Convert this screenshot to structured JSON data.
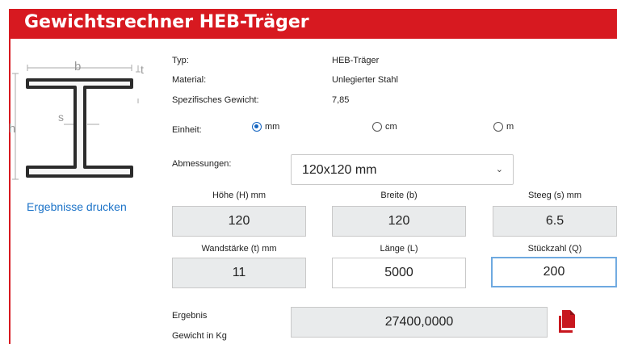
{
  "header": {
    "title": "Gewichtsrechner HEB-Träger"
  },
  "diagram": {
    "label_b": "b",
    "label_t": "t",
    "label_s": "s",
    "label_h": "h"
  },
  "sidebar": {
    "print_link": "Ergebnisse drucken"
  },
  "info": [
    {
      "label": "Typ:",
      "value": "HEB-Träger"
    },
    {
      "label": "Material:",
      "value": "Unlegierter Stahl"
    },
    {
      "label": "Spezifisches Gewicht:",
      "value": "7,85"
    }
  ],
  "unit": {
    "label": "Einheit:",
    "options": [
      {
        "label": "mm",
        "checked": true
      },
      {
        "label": "cm",
        "checked": false
      },
      {
        "label": "m",
        "checked": false
      }
    ]
  },
  "dimensions": {
    "label": "Abmessungen:",
    "selected": "120x120 mm"
  },
  "fields": {
    "height": {
      "label": "Höhe (H) mm",
      "value": "120"
    },
    "width": {
      "label": "Breite (b)",
      "value": "120"
    },
    "web": {
      "label": "Steeg (s) mm",
      "value": "6.5"
    },
    "thickness": {
      "label": "Wandstärke (t) mm",
      "value": "11"
    },
    "length": {
      "label": "Länge (L)",
      "value": "5000"
    },
    "quantity": {
      "label": "Stückzahl (Q)",
      "value": "200"
    }
  },
  "result": {
    "label1": "Ergebnis",
    "label2": "Gewicht in Kg",
    "value": "27400,0000"
  },
  "colors": {
    "brand": "#d71920",
    "link": "#1c73c8",
    "radio": "#1565c0"
  },
  "icons": {
    "export": "pdf-document-icon"
  }
}
